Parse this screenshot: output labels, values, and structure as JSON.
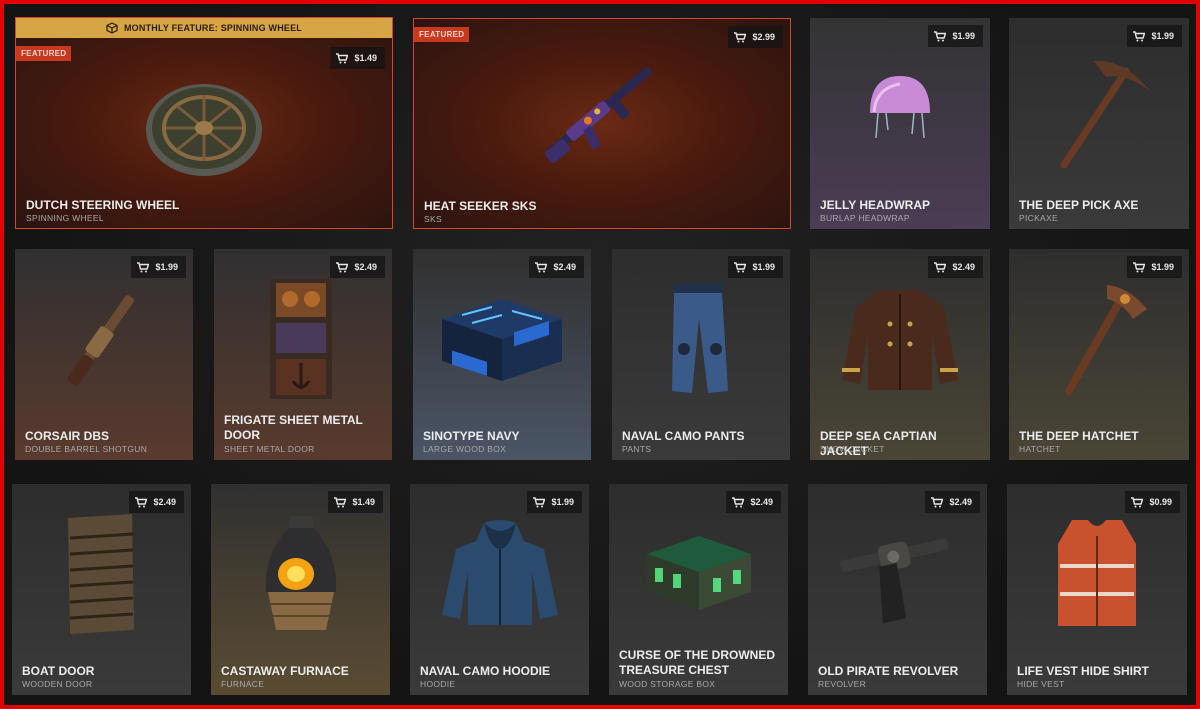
{
  "banner": {
    "text": "MONTHLY FEATURE: SPINNING WHEEL"
  },
  "featured_label": "FEATURED",
  "items": [
    {
      "name": "DUTCH STEERING WHEEL",
      "type": "SPINNING WHEEL",
      "price": "$1.49",
      "icon": "steering-wheel-icon"
    },
    {
      "name": "HEAT SEEKER SKS",
      "type": "SKS",
      "price": "$2.99",
      "icon": "rifle-icon"
    },
    {
      "name": "JELLY HEADWRAP",
      "type": "BURLAP HEADWRAP",
      "price": "$1.99",
      "icon": "jellyfish-headwrap-icon"
    },
    {
      "name": "THE DEEP PICK AXE",
      "type": "PICKAXE",
      "price": "$1.99",
      "icon": "pickaxe-icon"
    },
    {
      "name": "CORSAIR DBS",
      "type": "DOUBLE BARREL SHOTGUN",
      "price": "$1.99",
      "icon": "shotgun-icon"
    },
    {
      "name": "FRIGATE SHEET METAL DOOR",
      "type": "SHEET METAL DOOR",
      "price": "$2.49",
      "icon": "metal-door-icon"
    },
    {
      "name": "SINOTYPE NAVY",
      "type": "LARGE WOOD BOX",
      "price": "$2.49",
      "icon": "large-box-icon"
    },
    {
      "name": "NAVAL CAMO PANTS",
      "type": "PANTS",
      "price": "$1.99",
      "icon": "pants-icon"
    },
    {
      "name": "DEEP SEA CAPTIAN JACKET",
      "type": "SNOW JACKET",
      "price": "$2.49",
      "icon": "jacket-icon"
    },
    {
      "name": "THE DEEP HATCHET",
      "type": "HATCHET",
      "price": "$1.99",
      "icon": "hatchet-icon"
    },
    {
      "name": "BOAT DOOR",
      "type": "WOODEN DOOR",
      "price": "$2.49",
      "icon": "wooden-door-icon"
    },
    {
      "name": "CASTAWAY FURNACE",
      "type": "FURNACE",
      "price": "$1.49",
      "icon": "furnace-icon"
    },
    {
      "name": "NAVAL CAMO HOODIE",
      "type": "HOODIE",
      "price": "$1.99",
      "icon": "hoodie-icon"
    },
    {
      "name": "CURSE OF THE DROWNED TREASURE CHEST",
      "type": "WOOD STORAGE BOX",
      "price": "$2.49",
      "icon": "storage-box-icon"
    },
    {
      "name": "OLD PIRATE REVOLVER",
      "type": "REVOLVER",
      "price": "$2.49",
      "icon": "revolver-icon"
    },
    {
      "name": "LIFE VEST HIDE SHIRT",
      "type": "HIDE VEST",
      "price": "$0.99",
      "icon": "life-vest-icon"
    }
  ],
  "colors": {
    "featured_border": "#d8452b",
    "banner": "#d6a646",
    "frame": "#e00000"
  }
}
